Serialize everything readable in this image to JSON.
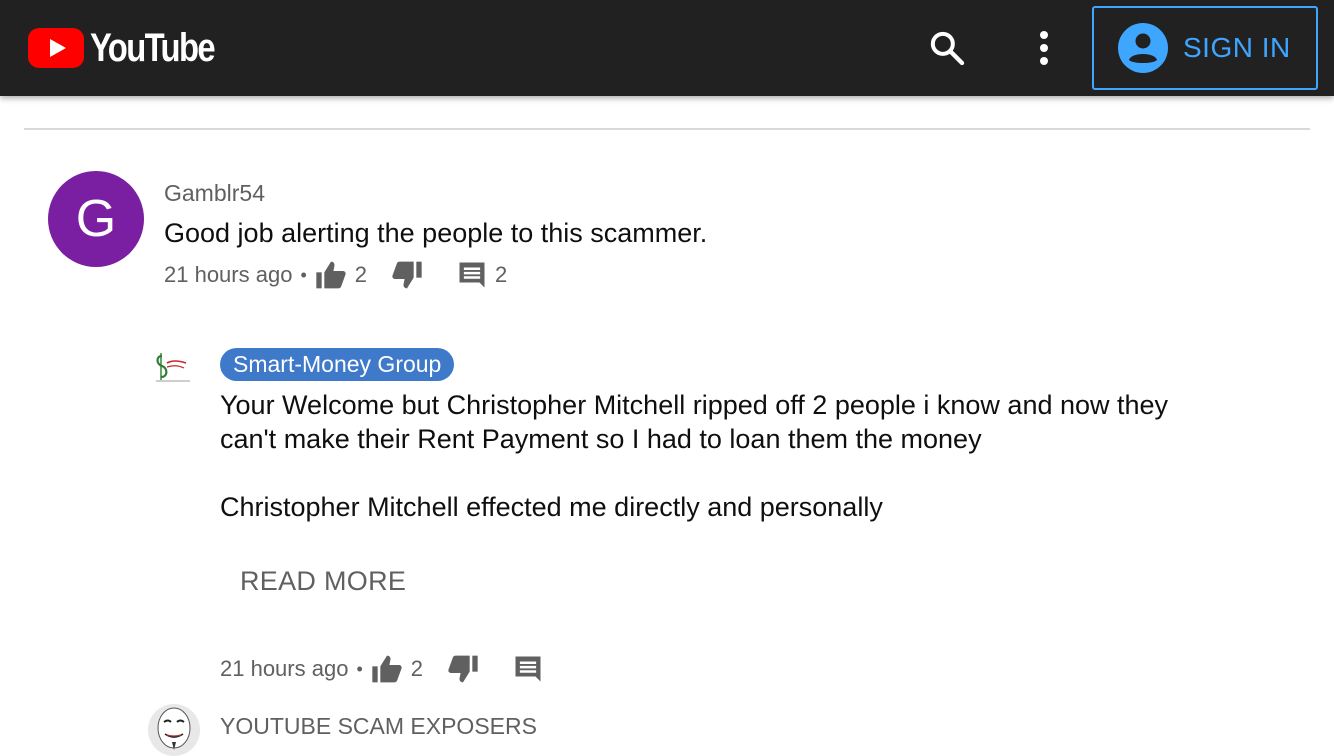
{
  "header": {
    "logo_text": "YouTube",
    "signin_label": "SIGN IN",
    "brand_color": "#ff0000",
    "accent_color": "#3ea6ff",
    "icons": [
      "youtube-logo-icon",
      "search-icon",
      "more-vert-icon",
      "account-circle-icon"
    ]
  },
  "comments": [
    {
      "avatar_letter": "G",
      "avatar_color": "#7b1fa2",
      "author": "Gamblr54",
      "text": "Good job alerting the people to this scammer.",
      "time": "21 hours ago",
      "separator": "•",
      "likes": "2",
      "replies": "2"
    }
  ],
  "replies": [
    {
      "author": "Smart-Money Group",
      "author_badge_color": "#3f79c9",
      "text": "Your Welcome but Christopher Mitchell ripped off 2 people i know and now they\ncan't make their Rent Payment so I had to loan them the money\n\nChristopher Mitchell effected me directly and personally",
      "read_more": "READ MORE",
      "time": "21 hours ago",
      "separator": "•",
      "likes": "2"
    },
    {
      "author": "YOUTUBE SCAM EXPOSERS"
    }
  ]
}
